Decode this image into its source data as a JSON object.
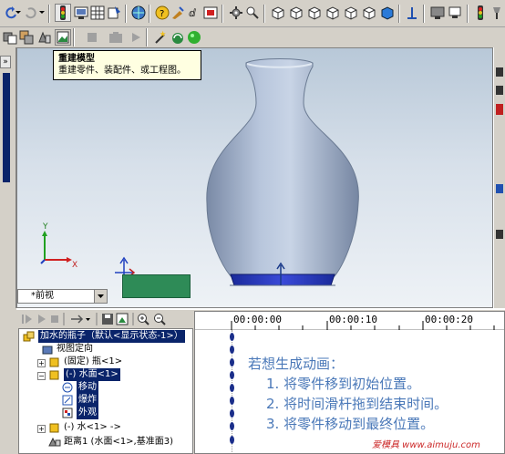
{
  "tooltip": {
    "title": "重建模型",
    "desc": "重建零件、装配件、或工程图。"
  },
  "view": {
    "current": "*前视"
  },
  "timeline": {
    "ticks": [
      "00:00:00",
      "00:00:10",
      "00:00:20"
    ]
  },
  "tree": {
    "items": [
      {
        "label": "加水的瓶子（默认<显示状态-1>）",
        "selected": true
      },
      {
        "label": "视图定向"
      },
      {
        "label": "(固定) 瓶<1>"
      },
      {
        "label": "(-) 水面<1>",
        "selected": true
      },
      {
        "label": "移动"
      },
      {
        "label": "爆炸"
      },
      {
        "label": "外观"
      },
      {
        "label": "(-) 水<1> ->"
      },
      {
        "label": "距离1 (水面<1>,基准面3)"
      }
    ]
  },
  "instructions": {
    "heading": "若想生成动画：",
    "step1": "1. 将零件移到初始位置。",
    "step2": "2. 将时间滑杆拖到结束时间。",
    "step3": "3. 将零件移动到最终位置。"
  },
  "watermark": "爱模具 www.aimuju.com",
  "colors": {
    "accent": "#0a246a",
    "instruction_text": "#4a78b8",
    "tooltip_bg": "#ffffe1"
  }
}
